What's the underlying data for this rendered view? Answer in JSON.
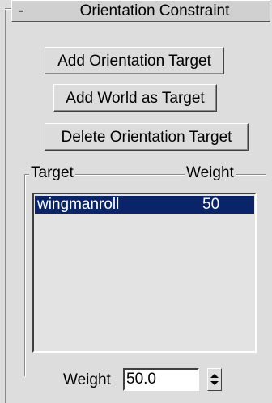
{
  "rollout": {
    "collapse_symbol": "-",
    "title": "Orientation Constraint"
  },
  "buttons": {
    "add_orientation_target": "Add Orientation Target",
    "add_world_as_target": "Add World as Target",
    "delete_orientation_target": "Delete Orientation Target"
  },
  "target_list": {
    "header_target": "Target",
    "header_weight": "Weight",
    "rows": [
      {
        "name": "wingmanroll",
        "weight": "50",
        "selected": true
      }
    ]
  },
  "weight_control": {
    "label": "Weight",
    "value": "50.0"
  },
  "colors": {
    "panel_bg": "#dddddd",
    "selection_bg": "#0a246a",
    "selection_text": "#ffffff"
  }
}
